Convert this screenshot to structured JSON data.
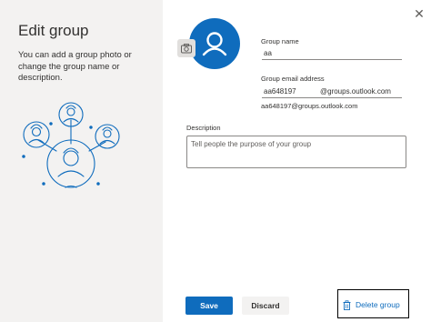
{
  "dialog": {
    "title": "Edit group",
    "description": "You can add a group photo or change the group name or description.",
    "close_glyph": "✕"
  },
  "form": {
    "group_name": {
      "label": "Group name",
      "value": "aa"
    },
    "group_email": {
      "label": "Group email address",
      "value": "aa648197",
      "domain": "@groups.outlook.com",
      "preview": "aa648197@groups.outlook.com"
    },
    "description": {
      "label": "Description",
      "placeholder": "Tell people the purpose of your group"
    }
  },
  "footer": {
    "save_label": "Save",
    "discard_label": "Discard",
    "delete_label": "Delete group"
  },
  "colors": {
    "accent": "#0f6cbd",
    "left_pane": "#f3f2f1",
    "highlight_border": "#000000"
  },
  "icons": [
    "people-illustration",
    "avatar-person-icon",
    "camera-icon",
    "close-icon",
    "trash-icon"
  ]
}
